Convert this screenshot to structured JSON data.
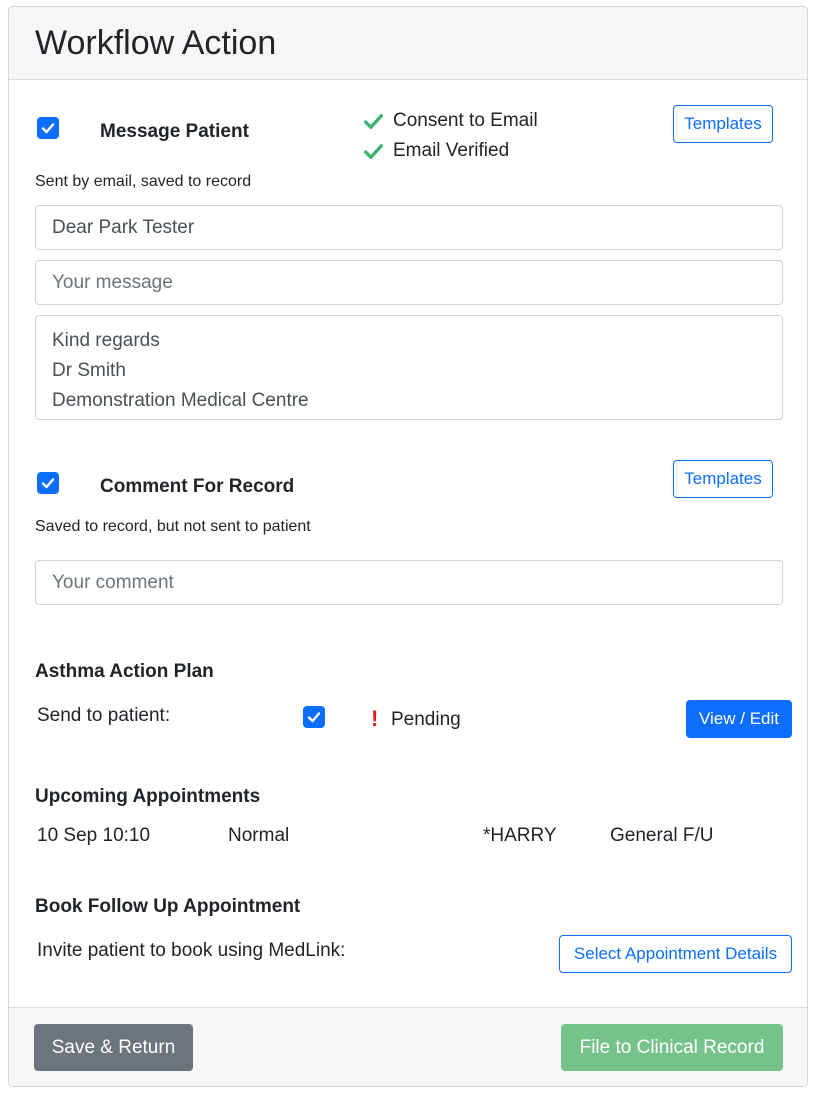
{
  "header": {
    "title": "Workflow Action"
  },
  "message_patient": {
    "checked": true,
    "label": "Message Patient",
    "status": [
      "Consent to Email",
      "Email Verified"
    ],
    "templates_label": "Templates",
    "note": "Sent by email, saved to record",
    "greeting": "Dear Park Tester",
    "message_placeholder": "Your message",
    "signature": "Kind regards\nDr Smith\nDemonstration Medical Centre"
  },
  "comment_record": {
    "checked": true,
    "label": "Comment For Record",
    "templates_label": "Templates",
    "note": "Saved to record, but not sent to patient",
    "comment_placeholder": "Your comment"
  },
  "asthma_plan": {
    "title": "Asthma Action Plan",
    "send_label": "Send to patient:",
    "send_checked": true,
    "status_mark": "!",
    "status_text": "Pending",
    "view_edit_label": "View / Edit"
  },
  "upcoming": {
    "title": "Upcoming Appointments",
    "rows": [
      {
        "datetime": "10 Sep 10:10",
        "type": "Normal",
        "clinician": "*HARRY",
        "reason": "General F/U"
      }
    ]
  },
  "follow_up": {
    "title": "Book Follow Up Appointment",
    "invite_label": "Invite patient to book using MedLink:",
    "select_label": "Select Appointment Details"
  },
  "footer": {
    "save_label": "Save & Return",
    "file_label": "File to Clinical Record"
  },
  "colors": {
    "primary": "#0d6efd",
    "success_check": "#3cb46e",
    "alert": "#dc1e1e",
    "secondary": "#6c757d",
    "success_disabled": "#75c38b"
  }
}
